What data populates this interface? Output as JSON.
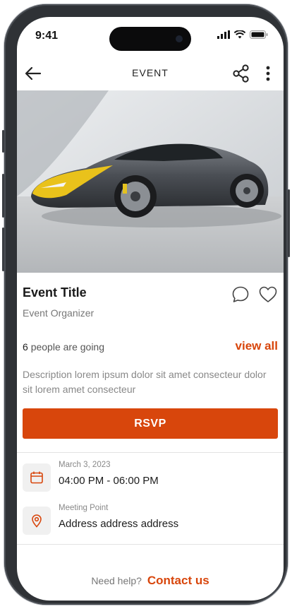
{
  "status": {
    "time": "9:41"
  },
  "header": {
    "title": "EVENT"
  },
  "event": {
    "title": "Event Title",
    "organizer": "Event Organizer",
    "going_count": "6",
    "going_text": "people are going",
    "view_all": "view all",
    "description": "Description lorem ipsum dolor sit amet consecteur dolor sit lorem amet consecteur",
    "rsvp_label": "RSVP"
  },
  "details": {
    "date_label": "March 3, 2023",
    "time_range": "04:00 PM - 06:00 PM",
    "location_label": "Meeting Point",
    "address": "Address address address"
  },
  "footer": {
    "help_text": "Need help?",
    "contact_label": "Contact us"
  },
  "colors": {
    "accent": "#d8460c"
  },
  "icons": [
    "back-arrow-icon",
    "share-icon",
    "more-vertical-icon",
    "comment-icon",
    "heart-icon",
    "calendar-icon",
    "location-pin-icon"
  ]
}
